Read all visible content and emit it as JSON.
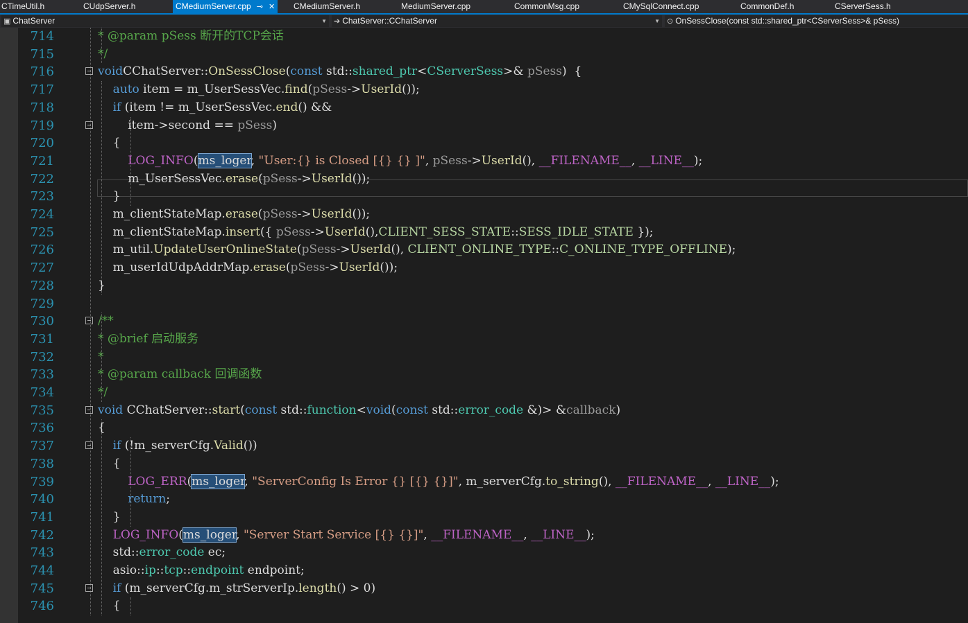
{
  "tabs": [
    {
      "label": "CTimeUtil.h",
      "active": false
    },
    {
      "label": "CUdpServer.h",
      "active": false
    },
    {
      "label": "CMediumServer.cpp",
      "active": true
    },
    {
      "label": "CMediumServer.h",
      "active": false
    },
    {
      "label": "MediumServer.cpp",
      "active": false
    },
    {
      "label": "CommonMsg.cpp",
      "active": false
    },
    {
      "label": "CMySqlConnect.cpp",
      "active": false
    },
    {
      "label": "CommonDef.h",
      "active": false
    },
    {
      "label": "CServerSess.h",
      "active": false
    }
  ],
  "tab_pin_glyph": "⊸",
  "tab_close_glyph": "✕",
  "navbar": {
    "project": "ChatServer",
    "scope": "ChatServer::CChatServer",
    "member": "OnSessClose(const std::shared_ptr<CServerSess>& pSess)"
  },
  "colors": {
    "accent": "#007acc",
    "keyword": "#569cd6",
    "type": "#4ec9b0",
    "comment": "#57a64a",
    "string": "#d69d85",
    "macro": "#bd63c5",
    "enum": "#b8d7a3",
    "parameter": "#9a9a9a",
    "line_number": "#2b91af",
    "background": "#1e1e1e"
  },
  "editor": {
    "current_line": 721,
    "lines": [
      {
        "n": "714",
        "segs": [
          [
            "cm",
            "* @param pSess 断开的TCP会话"
          ]
        ]
      },
      {
        "n": "715",
        "segs": [
          [
            "cm",
            "*/"
          ]
        ]
      },
      {
        "n": "716",
        "fold": true,
        "segs": [
          [
            "kw",
            "void"
          ],
          [
            "",
            "CChatServer::"
          ],
          [
            "fn",
            "OnSessClose"
          ],
          [
            "",
            "("
          ],
          [
            "kw",
            "const"
          ],
          [
            "",
            " std::"
          ],
          [
            "ty",
            "shared_ptr"
          ],
          [
            "",
            "<"
          ],
          [
            "ty",
            "CServerSess"
          ],
          [
            "",
            ">& "
          ],
          [
            "pr",
            "pSess"
          ],
          [
            "",
            ")  {"
          ]
        ]
      },
      {
        "n": "717",
        "segs": [
          [
            "",
            "    "
          ],
          [
            "kw",
            "auto"
          ],
          [
            "",
            " item = m_UserSessVec."
          ],
          [
            "fn",
            "find"
          ],
          [
            "",
            "("
          ],
          [
            "pr",
            "pSess"
          ],
          [
            "",
            "->"
          ],
          [
            "fn",
            "UserId"
          ],
          [
            "",
            "());"
          ]
        ]
      },
      {
        "n": "718",
        "segs": [
          [
            "",
            "    "
          ],
          [
            "kw",
            "if"
          ],
          [
            "",
            " (item != m_UserSessVec."
          ],
          [
            "fn",
            "end"
          ],
          [
            "",
            "() &&"
          ]
        ]
      },
      {
        "n": "719",
        "fold": true,
        "segs": [
          [
            "",
            "        item->second == "
          ],
          [
            "pr",
            "pSess"
          ],
          [
            "",
            ")"
          ]
        ]
      },
      {
        "n": "720",
        "segs": [
          [
            "",
            "    {"
          ]
        ]
      },
      {
        "n": "721",
        "segs": [
          [
            "",
            "        "
          ],
          [
            "mac",
            "LOG_INFO"
          ],
          [
            "",
            "("
          ],
          [
            "hl",
            "ms_loger"
          ],
          [
            "",
            ", "
          ],
          [
            "st",
            "\"User:{} is Closed [{} {} ]\""
          ],
          [
            "",
            ", "
          ],
          [
            "pr",
            "pSess"
          ],
          [
            "",
            "->"
          ],
          [
            "fn",
            "UserId"
          ],
          [
            "",
            "(), "
          ],
          [
            "mac",
            "__FILENAME__"
          ],
          [
            "",
            ", "
          ],
          [
            "mac",
            "__LINE__"
          ],
          [
            "",
            ");"
          ]
        ]
      },
      {
        "n": "722",
        "segs": [
          [
            "",
            "        m_UserSessVec."
          ],
          [
            "fn",
            "erase"
          ],
          [
            "",
            "("
          ],
          [
            "pr",
            "pSess"
          ],
          [
            "",
            "->"
          ],
          [
            "fn",
            "UserId"
          ],
          [
            "",
            "());"
          ]
        ]
      },
      {
        "n": "723",
        "segs": [
          [
            "",
            "    }"
          ]
        ]
      },
      {
        "n": "724",
        "segs": [
          [
            "",
            "    m_clientStateMap."
          ],
          [
            "fn",
            "erase"
          ],
          [
            "",
            "("
          ],
          [
            "pr",
            "pSess"
          ],
          [
            "",
            "->"
          ],
          [
            "fn",
            "UserId"
          ],
          [
            "",
            "());"
          ]
        ]
      },
      {
        "n": "725",
        "segs": [
          [
            "",
            "    m_clientStateMap."
          ],
          [
            "fn",
            "insert"
          ],
          [
            "",
            "({ "
          ],
          [
            "pr",
            "pSess"
          ],
          [
            "",
            "->"
          ],
          [
            "fn",
            "UserId"
          ],
          [
            "",
            "(),"
          ],
          [
            "en",
            "CLIENT_SESS_STATE"
          ],
          [
            "",
            "::"
          ],
          [
            "en",
            "SESS_IDLE_STATE"
          ],
          [
            "",
            " });"
          ]
        ]
      },
      {
        "n": "726",
        "segs": [
          [
            "",
            "    m_util."
          ],
          [
            "fn",
            "UpdateUserOnlineState"
          ],
          [
            "",
            "("
          ],
          [
            "pr",
            "pSess"
          ],
          [
            "",
            "->"
          ],
          [
            "fn",
            "UserId"
          ],
          [
            "",
            "(), "
          ],
          [
            "en",
            "CLIENT_ONLINE_TYPE"
          ],
          [
            "",
            "::"
          ],
          [
            "en",
            "C_ONLINE_TYPE_OFFLINE"
          ],
          [
            "",
            ");"
          ]
        ]
      },
      {
        "n": "727",
        "segs": [
          [
            "",
            "    m_userIdUdpAddrMap."
          ],
          [
            "fn",
            "erase"
          ],
          [
            "",
            "("
          ],
          [
            "pr",
            "pSess"
          ],
          [
            "",
            "->"
          ],
          [
            "fn",
            "UserId"
          ],
          [
            "",
            "());"
          ]
        ]
      },
      {
        "n": "728",
        "segs": [
          [
            "",
            "}"
          ]
        ]
      },
      {
        "n": "729",
        "segs": []
      },
      {
        "n": "730",
        "fold": true,
        "segs": [
          [
            "cm",
            "/**"
          ]
        ]
      },
      {
        "n": "731",
        "segs": [
          [
            "cm",
            "* @brief 启动服务"
          ]
        ]
      },
      {
        "n": "732",
        "segs": [
          [
            "cm",
            "*"
          ]
        ]
      },
      {
        "n": "733",
        "segs": [
          [
            "cm",
            "* @param callback 回调函数"
          ]
        ]
      },
      {
        "n": "734",
        "segs": [
          [
            "cm",
            "*/"
          ]
        ]
      },
      {
        "n": "735",
        "fold": true,
        "segs": [
          [
            "kw",
            "void"
          ],
          [
            "",
            " CChatServer::"
          ],
          [
            "fn",
            "start"
          ],
          [
            "",
            "("
          ],
          [
            "kw",
            "const"
          ],
          [
            "",
            " std::"
          ],
          [
            "ty",
            "function"
          ],
          [
            "",
            "<"
          ],
          [
            "kw",
            "void"
          ],
          [
            "",
            "("
          ],
          [
            "kw",
            "const"
          ],
          [
            "",
            " std::"
          ],
          [
            "ty",
            "error_code"
          ],
          [
            "",
            " &)> &"
          ],
          [
            "pr",
            "callback"
          ],
          [
            "",
            ")"
          ]
        ]
      },
      {
        "n": "736",
        "segs": [
          [
            "",
            "{"
          ]
        ]
      },
      {
        "n": "737",
        "fold": true,
        "segs": [
          [
            "",
            "    "
          ],
          [
            "kw",
            "if"
          ],
          [
            "",
            " (!m_serverCfg."
          ],
          [
            "fn",
            "Valid"
          ],
          [
            "",
            "())"
          ]
        ]
      },
      {
        "n": "738",
        "segs": [
          [
            "",
            "    {"
          ]
        ]
      },
      {
        "n": "739",
        "segs": [
          [
            "",
            "        "
          ],
          [
            "mac",
            "LOG_ERR"
          ],
          [
            "",
            "("
          ],
          [
            "hl",
            "ms_loger"
          ],
          [
            "",
            ", "
          ],
          [
            "st",
            "\"ServerConfig Is Error {} [{} {}]\""
          ],
          [
            "",
            ", m_serverCfg."
          ],
          [
            "fn",
            "to_string"
          ],
          [
            "",
            "(), "
          ],
          [
            "mac",
            "__FILENAME__"
          ],
          [
            "",
            ", "
          ],
          [
            "mac",
            "__LINE__"
          ],
          [
            "",
            ");"
          ]
        ]
      },
      {
        "n": "740",
        "segs": [
          [
            "",
            "        "
          ],
          [
            "kw",
            "return"
          ],
          [
            "",
            ";"
          ]
        ]
      },
      {
        "n": "741",
        "segs": [
          [
            "",
            "    }"
          ]
        ]
      },
      {
        "n": "742",
        "segs": [
          [
            "",
            "    "
          ],
          [
            "mac",
            "LOG_INFO"
          ],
          [
            "",
            "("
          ],
          [
            "hl",
            "ms_loger"
          ],
          [
            "",
            ", "
          ],
          [
            "st",
            "\"Server Start Service [{} {}]\""
          ],
          [
            "",
            ", "
          ],
          [
            "mac",
            "__FILENAME__"
          ],
          [
            "",
            ", "
          ],
          [
            "mac",
            "__LINE__"
          ],
          [
            "",
            ");"
          ]
        ]
      },
      {
        "n": "743",
        "segs": [
          [
            "",
            "    std::"
          ],
          [
            "ty",
            "error_code"
          ],
          [
            "",
            " ec;"
          ]
        ]
      },
      {
        "n": "744",
        "segs": [
          [
            "",
            "    asio::"
          ],
          [
            "ty",
            "ip"
          ],
          [
            "",
            "::"
          ],
          [
            "ty",
            "tcp"
          ],
          [
            "",
            "::"
          ],
          [
            "ty",
            "endpoint"
          ],
          [
            "",
            " endpoint;"
          ]
        ]
      },
      {
        "n": "745",
        "fold": true,
        "segs": [
          [
            "",
            "    "
          ],
          [
            "kw",
            "if"
          ],
          [
            "",
            " (m_serverCfg.m_strServerIp."
          ],
          [
            "fn",
            "length"
          ],
          [
            "",
            "() > 0)"
          ]
        ]
      },
      {
        "n": "746",
        "segs": [
          [
            "",
            "    {"
          ]
        ]
      }
    ]
  }
}
